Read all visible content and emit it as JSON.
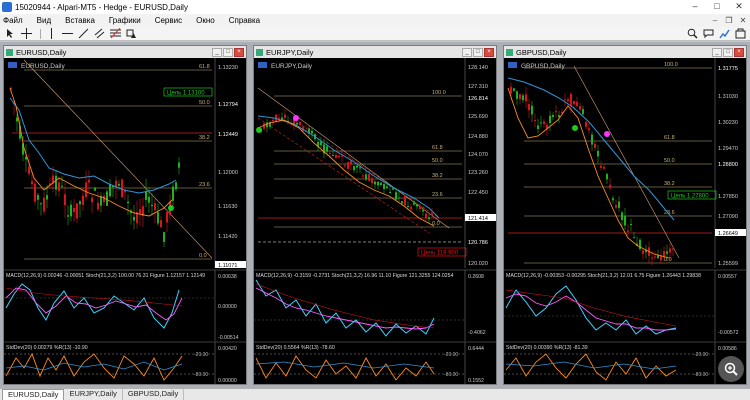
{
  "window": {
    "title": "15020944 - Alpari-MT5 - Hedge - EURUSD,Daily"
  },
  "menu": [
    "Файл",
    "Вид",
    "Вставка",
    "Графики",
    "Сервис",
    "Окно",
    "Справка"
  ],
  "tabs": [
    {
      "label": "EURUSD,Daily",
      "active": true
    },
    {
      "label": "EURJPY,Daily",
      "active": false
    },
    {
      "label": "GBPUSD,Daily",
      "active": false
    }
  ],
  "charts": [
    {
      "title": "EURUSD,Daily",
      "symbol_label": "EURUSD,Daily",
      "prices": [
        "1.13230",
        "1.12794",
        "1.12449",
        "1.12000",
        "1.11630",
        "1.11420",
        "1.11071",
        "0.00638",
        "0.00000",
        "-0.00514",
        "0.00420",
        "0.00000"
      ],
      "fib_levels": [
        "61.8",
        "50.0",
        "38.2",
        "23.6",
        "0.0"
      ],
      "tag": "Цель 1.13100",
      "macd_label": "MACD(12,26,9) 0.00246 -0.00051 Stoch(21,3,2) 100.00 76.31 Figure 1.12157 1.12149",
      "std_label": "StdDev(20) 0.00279 %R(13) -10.90",
      "rsi_levels": [
        "-20.00",
        "-80.00"
      ]
    },
    {
      "title": "EURJPY,Daily",
      "symbol_label": "EURJPY,Daily",
      "prices": [
        "128.140",
        "127.310",
        "126.814",
        "125.690",
        "124.880",
        "124.070",
        "123.260",
        "122.450",
        "121.414",
        "120.786",
        "120.020",
        "0.2608",
        "-0.4062",
        "0.6444",
        "0.1552"
      ],
      "fib_levels": [
        "100.0",
        "61.8",
        "50.0",
        "38.2",
        "23.6",
        "0.0"
      ],
      "tag": "Цель 119.900",
      "macd_label": "MACD(12,26,9) -0.3159 -0.2731 Stoch(21,3,2) 16.96 11.10 Figure 121.3255 124.0254",
      "std_label": "StdDev(20) 0.5564 %R(13) -78.60",
      "rsi_levels": [
        "-20.00",
        "-80.00"
      ]
    },
    {
      "title": "GBPUSD,Daily",
      "symbol_label": "GBPUSD,Daily",
      "prices": [
        "1.31775",
        "1.31030",
        "1.30230",
        "1.29470",
        "1.28800",
        "1.27850",
        "1.27090",
        "1.26649",
        "1.25599",
        "0.00557",
        "-0.00572",
        "0.00586"
      ],
      "fib_levels": [
        "100.0",
        "61.8",
        "50.0",
        "38.2",
        "23.6",
        "0.0"
      ],
      "tag": "Цель 1.27800",
      "macd_label": "MACD(12,26,9) -0.00353 -0.00295 Stoch(21,3,2) 12.01 6.75 Figure 1.26443 1.29838",
      "std_label": "StdDev(20) 0.00390 %R(13) -81.39",
      "rsi_levels": [
        "-20.00",
        "-80.00"
      ]
    }
  ],
  "colors": {
    "bull": "#1db31d",
    "bear": "#d8141d",
    "fib": "#c9b27a",
    "ma_blue": "#2f95d8",
    "ma_orange": "#ff8a1c",
    "stoch": "#ff5cff",
    "macd_cyan": "#3ad3ff",
    "tag_green": "#1ec81e",
    "tag_red": "#e01010"
  }
}
